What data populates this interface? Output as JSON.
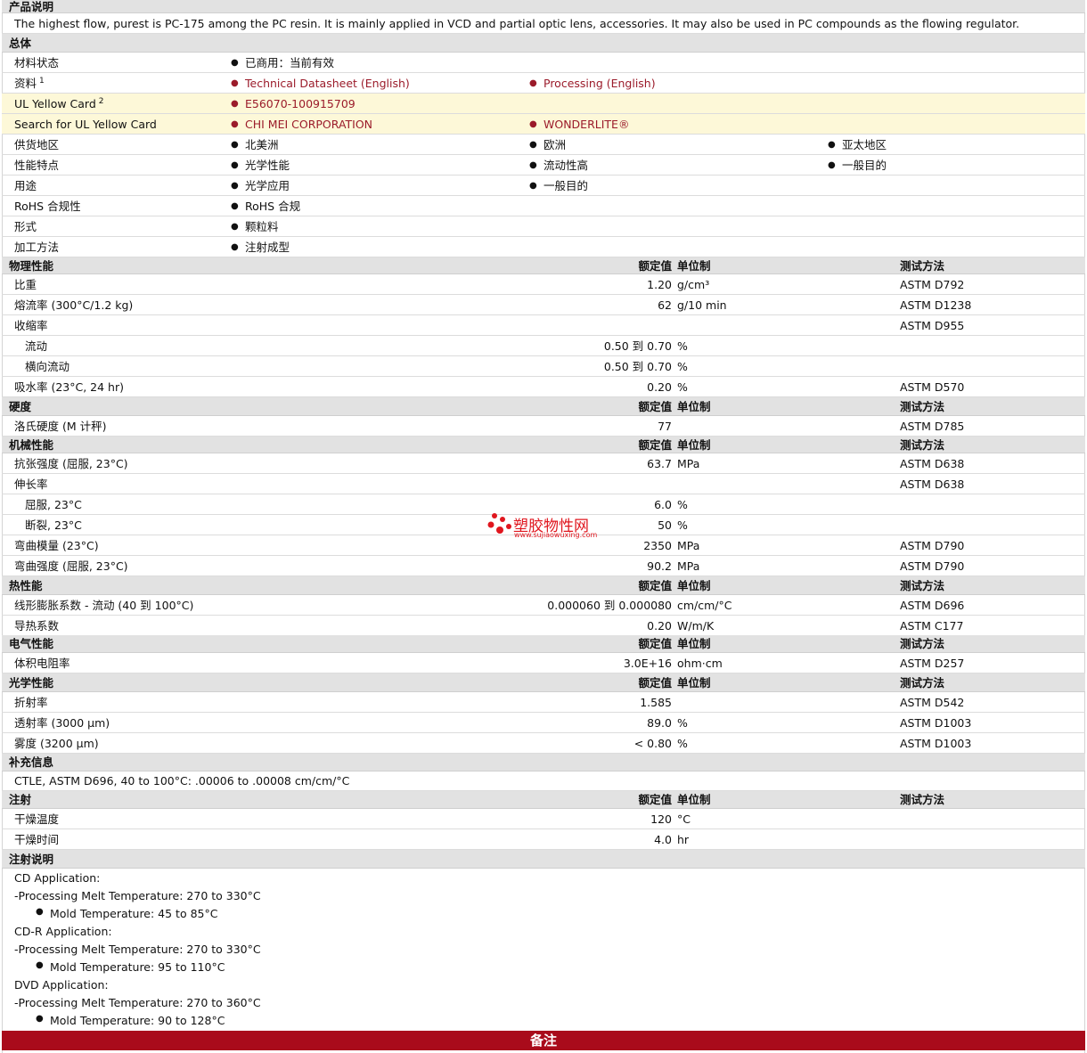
{
  "sections": {
    "product_description": "产品说明",
    "general": "总体",
    "physical": "物理性能",
    "hardness": "硬度",
    "mechanical": "机械性能",
    "thermal": "热性能",
    "electrical": "电气性能",
    "optical": "光学性能",
    "supplementary": "补充信息",
    "injection": "注射",
    "injection_notes": "注射说明",
    "footer": "备注"
  },
  "columns": {
    "nominal": "额定值",
    "unit": "单位制",
    "method": "测试方法"
  },
  "description": "The highest flow, purest is PC-175 among the PC resin. It is mainly applied in VCD and partial optic lens, accessories. It may also be used in PC compounds as the flowing regulator.",
  "general_rows": [
    {
      "label": "材料状态",
      "sup": "",
      "values": [
        "已商用：当前有效"
      ]
    },
    {
      "label": "资料",
      "sup": "1",
      "values": [
        "Technical Datasheet (English)",
        "Processing (English)"
      ],
      "links": true
    },
    {
      "label": "UL Yellow Card",
      "sup": "2",
      "values": [
        "E56070-100915709"
      ],
      "links": true,
      "highlight": true
    },
    {
      "label": "Search for UL Yellow Card",
      "sup": "",
      "values": [
        "CHI MEI CORPORATION",
        "WONDERLITE®"
      ],
      "links": true,
      "highlight": true
    },
    {
      "label": "供货地区",
      "sup": "",
      "values": [
        "北美洲",
        "欧洲",
        "亚太地区"
      ]
    },
    {
      "label": "性能特点",
      "sup": "",
      "values": [
        "光学性能",
        "流动性高",
        "一般目的"
      ]
    },
    {
      "label": "用途",
      "sup": "",
      "values": [
        "光学应用",
        "一般目的"
      ]
    },
    {
      "label": "RoHS 合规性",
      "sup": "",
      "values": [
        "RoHS 合规"
      ]
    },
    {
      "label": "形式",
      "sup": "",
      "values": [
        "颗粒料"
      ]
    },
    {
      "label": "加工方法",
      "sup": "",
      "values": [
        "注射成型"
      ]
    }
  ],
  "physical_rows": [
    {
      "label": "比重",
      "value": "1.20",
      "unit": "g/cm³",
      "method": "ASTM D792"
    },
    {
      "label": "熔流率 (300°C/1.2 kg)",
      "value": "62",
      "unit": "g/10 min",
      "method": "ASTM D1238"
    },
    {
      "label": "收缩率",
      "value": "",
      "unit": "",
      "method": "ASTM D955"
    },
    {
      "label": "流动",
      "value": "0.50 到  0.70",
      "unit": "%",
      "method": "",
      "indent": true
    },
    {
      "label": "横向流动",
      "value": "0.50 到  0.70",
      "unit": "%",
      "method": "",
      "indent": true
    },
    {
      "label": "吸水率 (23°C, 24 hr)",
      "value": "0.20",
      "unit": "%",
      "method": "ASTM D570"
    }
  ],
  "hardness_rows": [
    {
      "label": "洛氏硬度 (M 计秤)",
      "value": "77",
      "unit": "",
      "method": "ASTM D785"
    }
  ],
  "mechanical_rows": [
    {
      "label": "抗张强度 (屈服, 23°C)",
      "value": "63.7",
      "unit": "MPa",
      "method": "ASTM D638"
    },
    {
      "label": "伸长率",
      "value": "",
      "unit": "",
      "method": "ASTM D638"
    },
    {
      "label": "屈服, 23°C",
      "value": "6.0",
      "unit": "%",
      "method": "",
      "indent": true
    },
    {
      "label": "断裂, 23°C",
      "value": "50",
      "unit": "%",
      "method": "",
      "indent": true
    },
    {
      "label": "弯曲模量 (23°C)",
      "value": "2350",
      "unit": "MPa",
      "method": "ASTM D790"
    },
    {
      "label": "弯曲强度 (屈服, 23°C)",
      "value": "90.2",
      "unit": "MPa",
      "method": "ASTM D790"
    }
  ],
  "thermal_rows": [
    {
      "label": "线形膨胀系数 - 流动 (40 到  100°C)",
      "value": "0.000060 到  0.000080",
      "unit": "cm/cm/°C",
      "method": "ASTM D696"
    },
    {
      "label": "导热系数",
      "value": "0.20",
      "unit": "W/m/K",
      "method": "ASTM C177"
    }
  ],
  "electrical_rows": [
    {
      "label": "体积电阻率",
      "value": "3.0E+16",
      "unit": "ohm·cm",
      "method": "ASTM D257"
    }
  ],
  "optical_rows": [
    {
      "label": "折射率",
      "value": "1.585",
      "unit": "",
      "method": "ASTM D542"
    },
    {
      "label": "透射率 (3000 µm)",
      "value": "89.0",
      "unit": "%",
      "method": "ASTM D1003"
    },
    {
      "label": "雾度 (3200 µm)",
      "value": "< 0.80",
      "unit": "%",
      "method": "ASTM D1003"
    }
  ],
  "supplementary_text": "CTLE, ASTM D696, 40 to 100°C: .00006 to .00008 cm/cm/°C",
  "injection_rows": [
    {
      "label": "干燥温度",
      "value": "120",
      "unit": "°C"
    },
    {
      "label": "干燥时间",
      "value": "4.0",
      "unit": "hr"
    }
  ],
  "injection_notes": [
    {
      "text": "CD Application:",
      "bullet": false
    },
    {
      "text": "-Processing Melt Temperature: 270 to 330°C",
      "bullet": false
    },
    {
      "text": "Mold Temperature: 45 to 85°C",
      "bullet": true
    },
    {
      "text": "CD-R Application:",
      "bullet": false
    },
    {
      "text": "-Processing Melt Temperature: 270 to 330°C",
      "bullet": false
    },
    {
      "text": "Mold Temperature: 95 to 110°C",
      "bullet": true
    },
    {
      "text": "DVD Application:",
      "bullet": false
    },
    {
      "text": "-Processing Melt Temperature: 270 to 360°C",
      "bullet": false
    },
    {
      "text": "Mold Temperature: 90 to 128°C",
      "bullet": true
    }
  ],
  "watermark": {
    "text": "塑胶物性网",
    "url": "www.sujiaowuxing.com",
    "color": "#e0161e"
  }
}
